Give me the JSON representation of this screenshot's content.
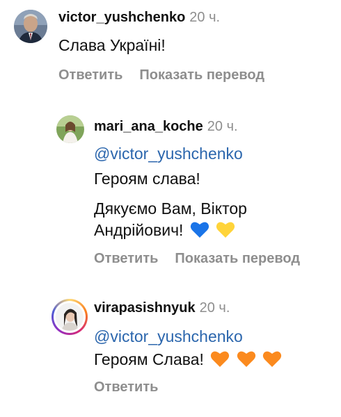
{
  "comments": [
    {
      "username": "victor_yushchenko",
      "time": "20 ч.",
      "lines": [
        "Слава Україні!"
      ],
      "reply": "Ответить",
      "translate": "Показать перевод"
    },
    {
      "username": "mari_ana_koche",
      "time": "20 ч.",
      "mention": "@victor_yushchenko",
      "lines": [
        "Героям слава!",
        "Дякуємо Вам, Віктор",
        "Андрійович!"
      ],
      "emoji": [
        "blue-heart",
        "yellow-heart"
      ],
      "reply": "Ответить",
      "translate": "Показать перевод"
    },
    {
      "username": "virapasishnyuk",
      "time": "20 ч.",
      "mention": "@victor_yushchenko",
      "lines": [
        "Героям Слава!"
      ],
      "emoji": [
        "orange-heart",
        "orange-heart",
        "orange-heart"
      ],
      "reply": "Ответить"
    }
  ],
  "colors": {
    "mention": "#2b66ad",
    "secondary": "#8e8e8e",
    "blue_heart": "#1a74e8",
    "yellow_heart": "#ffd43a",
    "orange_heart": "#fb8a1e"
  }
}
